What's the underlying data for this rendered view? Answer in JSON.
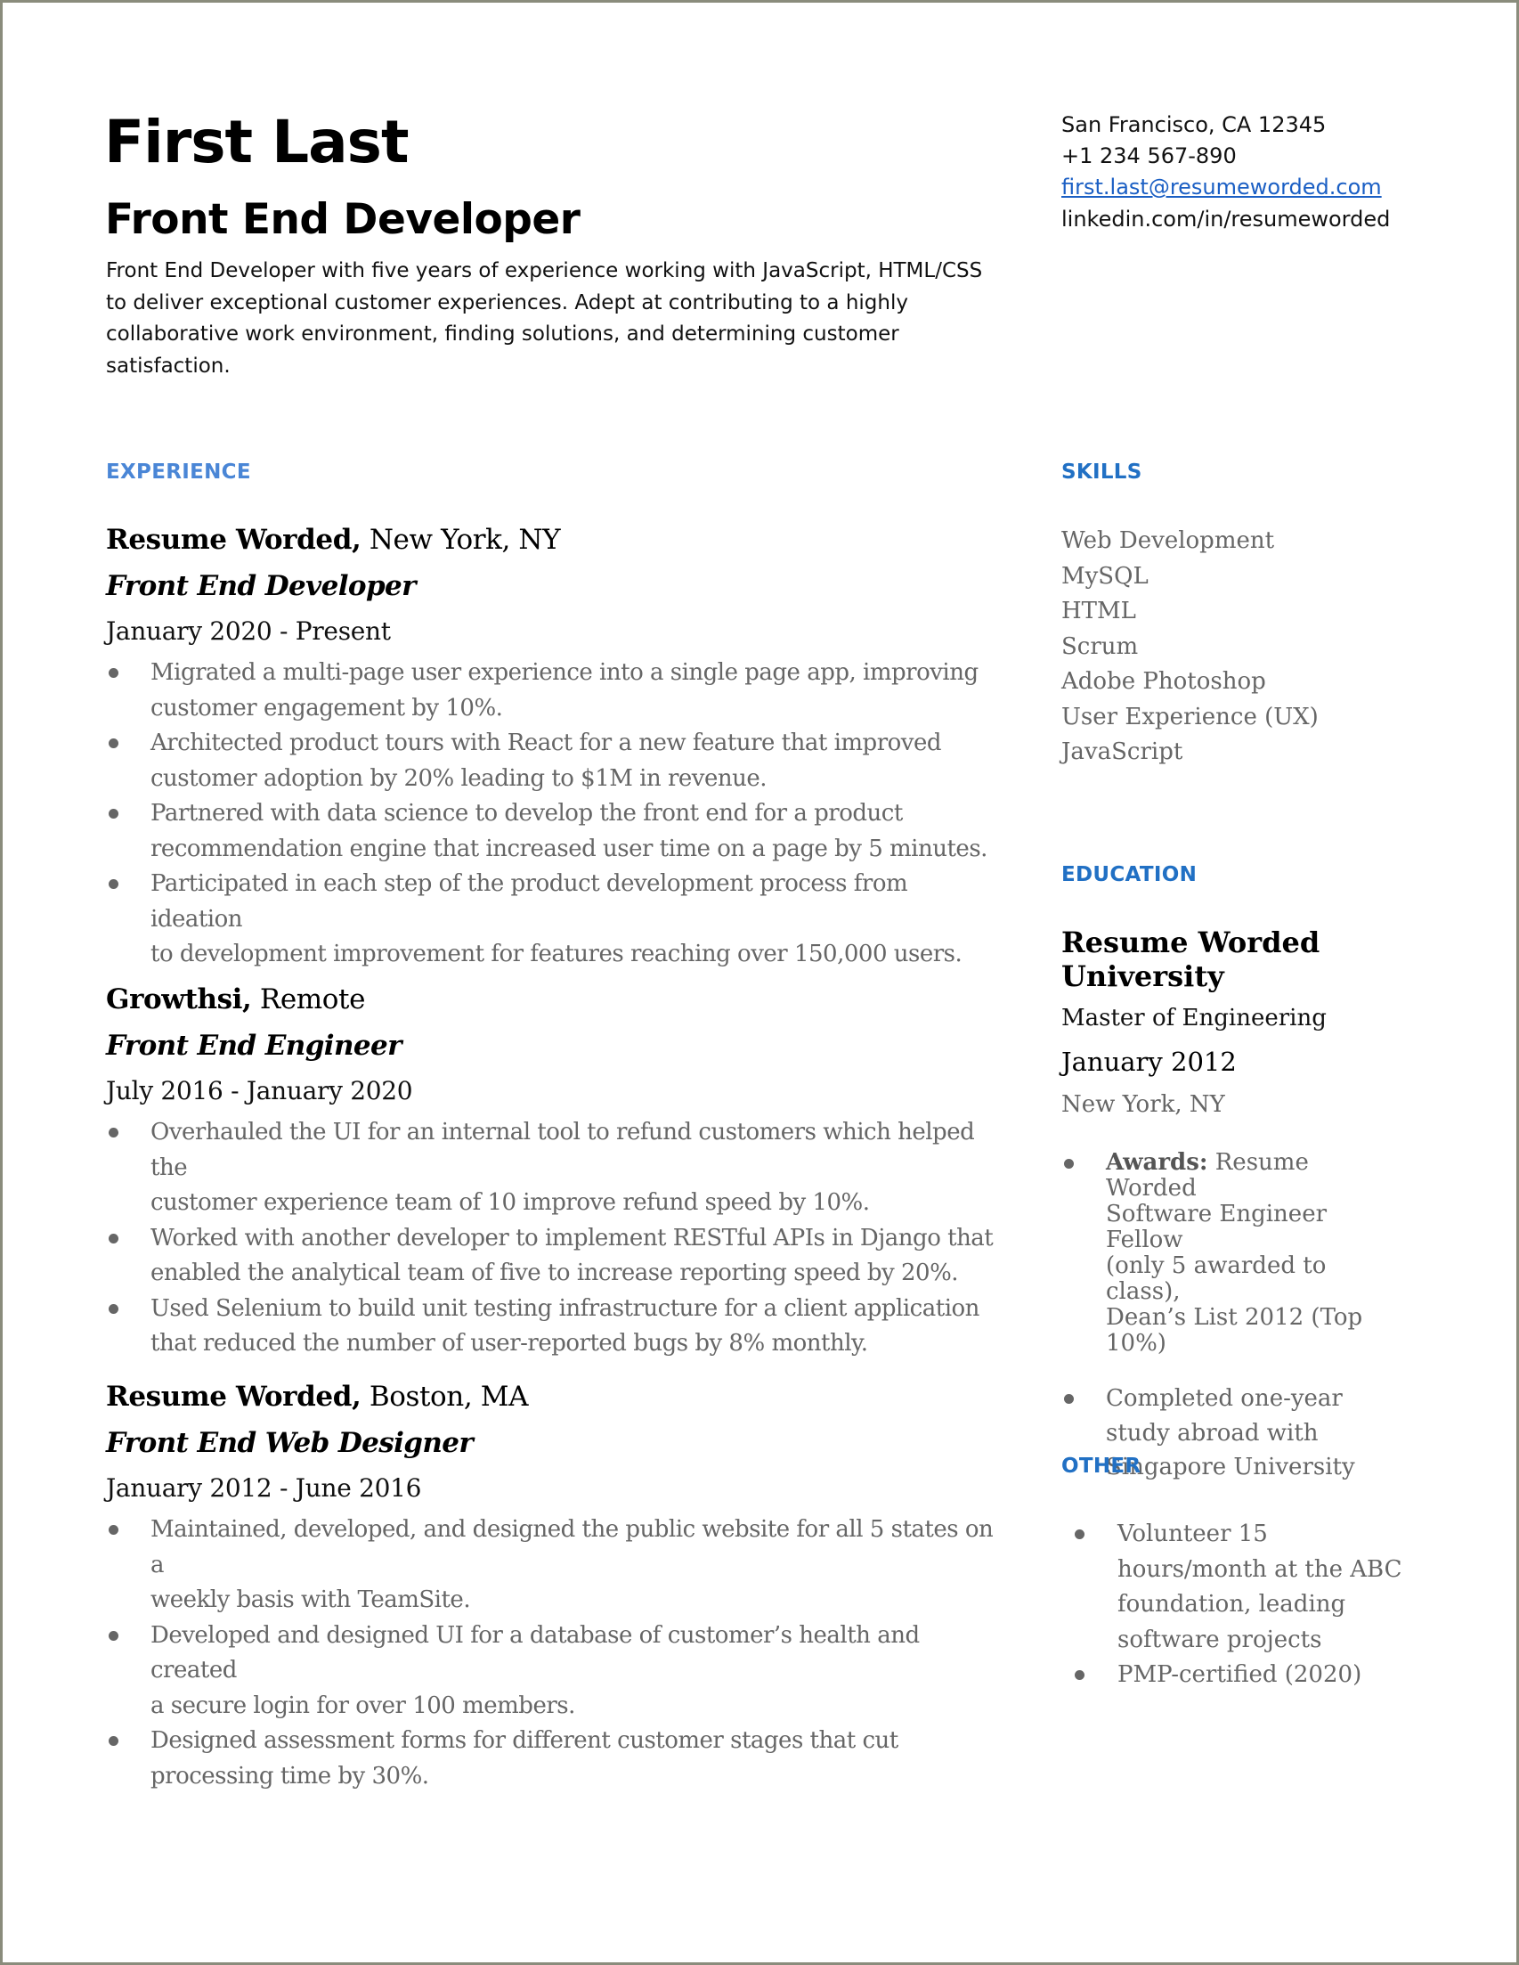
{
  "header": {
    "name": "First Last",
    "title": "Front End Developer",
    "summary_lines": [
      "Front End Developer with five years of experience working with JavaScript, HTML/CSS",
      "to deliver exceptional customer experiences. Adept at contributing to a highly",
      "collaborative work environment, finding solutions, and determining customer",
      "satisfaction."
    ]
  },
  "contact": {
    "location": "San Francisco, CA 12345",
    "phone": "+1 234 567-890",
    "email": "first.last@resumeworded.com",
    "linkedin": "linkedin.com/in/resumeworded"
  },
  "experience": {
    "heading": "EXPERIENCE",
    "jobs": [
      {
        "company": "Resume Worded,",
        "location": " New York, NY",
        "role": "Front End Developer",
        "dates": "January 2020 - Present",
        "bullets": [
          [
            "Migrated a multi-page user experience into a single page app, improving",
            "customer engagement by 10%."
          ],
          [
            "Architected product tours with React for a new feature that improved",
            "customer adoption by 20% leading to $1M in revenue."
          ],
          [
            "Partnered with data science to develop the front end for a product",
            "recommendation engine that increased user time on a page by 5 minutes."
          ],
          [
            "Participated in each step of the product development process from ideation",
            "to development improvement for features reaching over 150,000 users."
          ]
        ]
      },
      {
        "company": "Growthsi,",
        "location": " Remote",
        "role": "Front End Engineer",
        "dates": "July 2016 - January 2020",
        "bullets": [
          [
            "Overhauled the UI for an internal tool to refund customers which helped the",
            "customer experience team of 10 improve refund speed by 10%."
          ],
          [
            "Worked with another developer to implement RESTful APIs in Django that",
            "enabled the analytical team of five to increase reporting speed by 20%."
          ],
          [
            "Used Selenium to build unit testing infrastructure for a client application",
            "that reduced the number of user-reported bugs by 8% monthly."
          ]
        ]
      },
      {
        "company": "Resume Worded,",
        "location": " Boston, MA",
        "role": "Front End Web Designer",
        "dates": "January 2012 - June 2016",
        "bullets": [
          [
            "Maintained, developed, and designed the public website for all 5 states on a",
            "weekly basis with TeamSite."
          ],
          [
            "Developed and designed UI for a database of customer’s health and created",
            "a secure login for over 100 members."
          ],
          [
            "Designed assessment forms for different customer stages that cut",
            "processing time by 30%."
          ]
        ]
      }
    ]
  },
  "skills": {
    "heading": "SKILLS",
    "items": [
      "Web Development",
      "MySQL",
      "HTML",
      "Scrum",
      "Adobe Photoshop",
      "User Experience (UX)",
      "JavaScript"
    ]
  },
  "education": {
    "heading": "EDUCATION",
    "school_lines": [
      "Resume Worded",
      "University"
    ],
    "degree": "Master of Engineering",
    "date": "January 2012",
    "location": "New York, NY",
    "bullets": [
      {
        "bold": "Awards:",
        "lines": [
          " Resume Worded",
          "Software Engineer Fellow",
          "(only 5 awarded to class),",
          "Dean’s List 2012 (Top",
          "10%)"
        ]
      },
      {
        "bold": "",
        "lines": [
          "Completed one-year",
          "study abroad with",
          "Singapore University"
        ]
      }
    ]
  },
  "other": {
    "heading": "OTHER",
    "bullets": [
      [
        "Volunteer 15",
        "hours/month at the ABC",
        "foundation, leading",
        "software projects"
      ],
      [
        "PMP-certified (2020)"
      ]
    ]
  },
  "colors": {
    "accent_experience": "#4a86d6",
    "accent_sidebar": "#2170c4",
    "body_grey": "#666666",
    "link": "#1b5fc4"
  }
}
